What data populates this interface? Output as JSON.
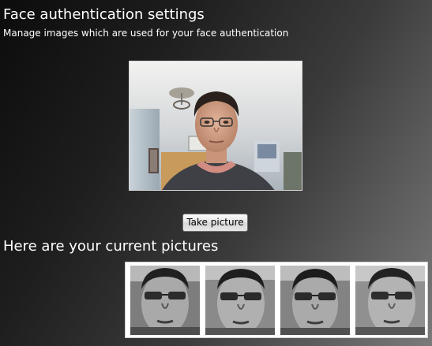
{
  "page": {
    "title": "Face authentication settings",
    "subtitle": "Manage images which are used for your face authentication"
  },
  "camera": {
    "preview_label": "webcam-preview"
  },
  "actions": {
    "take_picture_label": "Take picture"
  },
  "gallery": {
    "heading": "Here are your current pictures",
    "pictures": [
      {
        "index": 1
      },
      {
        "index": 2
      },
      {
        "index": 3
      },
      {
        "index": 4
      }
    ]
  }
}
